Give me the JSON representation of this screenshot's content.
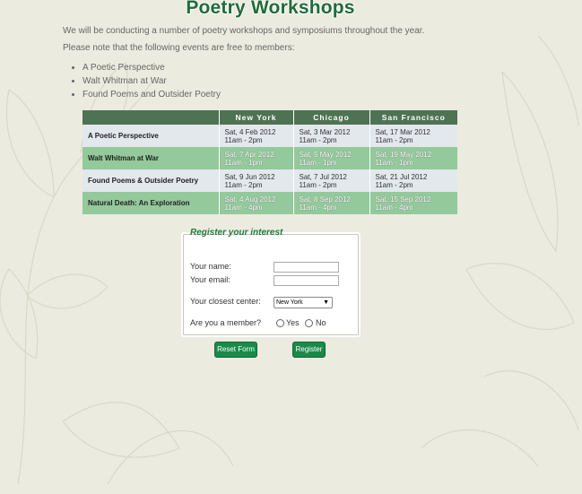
{
  "page": {
    "title": "Poetry Workshops",
    "intro_1": "We will be conducting a number of poetry workshops and symposiums throughout the year.",
    "intro_2": "Please note that the following events are free to members:"
  },
  "events_list": [
    "A Poetic Perspective",
    "Walt Whitman at War",
    "Found Poems and Outsider Poetry"
  ],
  "schedule": {
    "headers": [
      "",
      "New York",
      "Chicago",
      "San Francisco"
    ],
    "rows": [
      {
        "event": "A Poetic Perspective",
        "slots": [
          {
            "date": "Sat, 4 Feb 2012",
            "time": "11am - 2pm"
          },
          {
            "date": "Sat, 3 Mar 2012",
            "time": "11am - 2pm"
          },
          {
            "date": "Sat, 17 Mar 2012",
            "time": "11am - 2pm"
          }
        ]
      },
      {
        "event": "Walt Whitman at War",
        "slots": [
          {
            "date": "Sat, 7 Apr 2012",
            "time": "11am - 1pm"
          },
          {
            "date": "Sat, 5 May 2012",
            "time": "11am - 1pm"
          },
          {
            "date": "Sat, 19 May 2012",
            "time": "11am - 1pm"
          }
        ]
      },
      {
        "event": "Found Poems & Outsider Poetry",
        "slots": [
          {
            "date": "Sat, 9 Jun 2012",
            "time": "11am - 2pm"
          },
          {
            "date": "Sat, 7 Jul 2012",
            "time": "11am - 2pm"
          },
          {
            "date": "Sat, 21 Jul 2012",
            "time": "11am - 2pm"
          }
        ]
      },
      {
        "event": "Natural Death: An Exploration",
        "slots": [
          {
            "date": "Sat, 4 Aug 2012",
            "time": "11am - 4pm"
          },
          {
            "date": "Sat, 8 Sep 2012",
            "time": "11am - 4pm"
          },
          {
            "date": "Sat, 15 Sep 2012",
            "time": "11am - 4pm"
          }
        ]
      }
    ]
  },
  "form": {
    "legend": "Register your interest",
    "name_label": "Your name:",
    "name_value": "",
    "email_label": "Your email:",
    "email_value": "",
    "center_label": "Your closest center:",
    "center_selected": "New York",
    "member_label": "Are you a member?",
    "yes_label": "Yes",
    "no_label": "No",
    "reset_label": "Reset Form",
    "submit_label": "Register"
  },
  "colors": {
    "title": "#1e6b3b",
    "header_bg": "#4e7352",
    "row_odd": "#e3e8ed",
    "row_even": "#93c99b",
    "button": "#1a8a4a"
  }
}
